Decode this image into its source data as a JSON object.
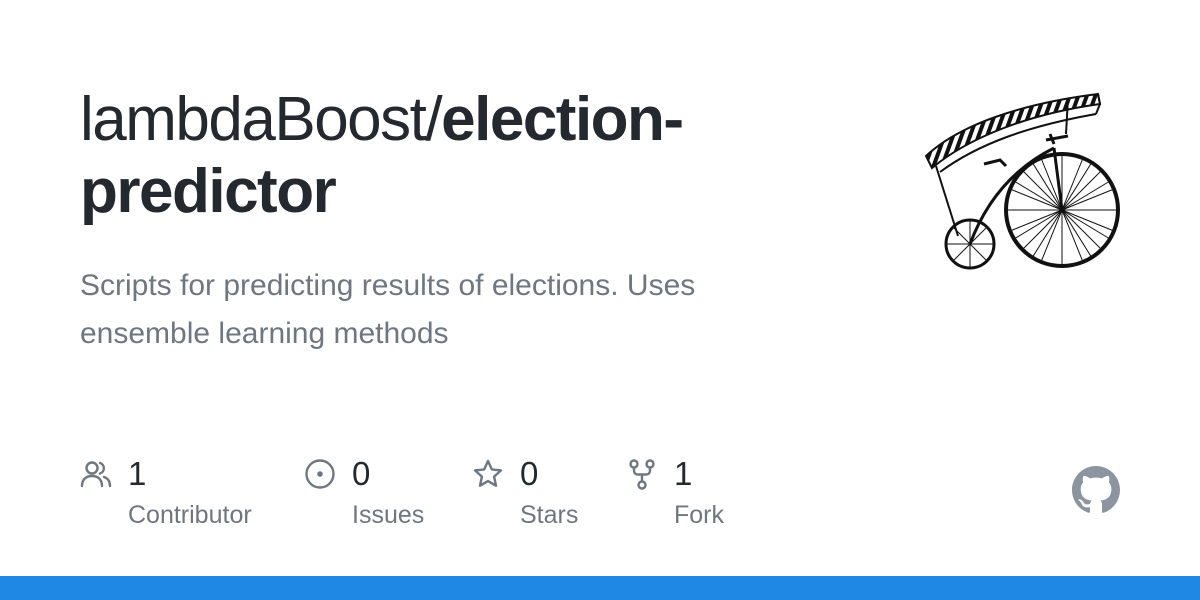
{
  "repo": {
    "owner": "lambdaBoost/",
    "name": "election-predictor",
    "description": "Scripts for predicting results of elections. Uses ensemble learning methods"
  },
  "stats": {
    "contributors": {
      "value": "1",
      "label": "Contributor",
      "icon": "people-icon"
    },
    "issues": {
      "value": "0",
      "label": "Issues",
      "icon": "issue-opened-icon"
    },
    "stars": {
      "value": "0",
      "label": "Stars",
      "icon": "star-icon"
    },
    "forks": {
      "value": "1",
      "label": "Fork",
      "icon": "repo-forked-icon"
    }
  },
  "colors": {
    "text_primary": "#24292f",
    "text_secondary": "#6e7781",
    "bar": "#1f88e5",
    "github_mark": "#8c959f"
  }
}
